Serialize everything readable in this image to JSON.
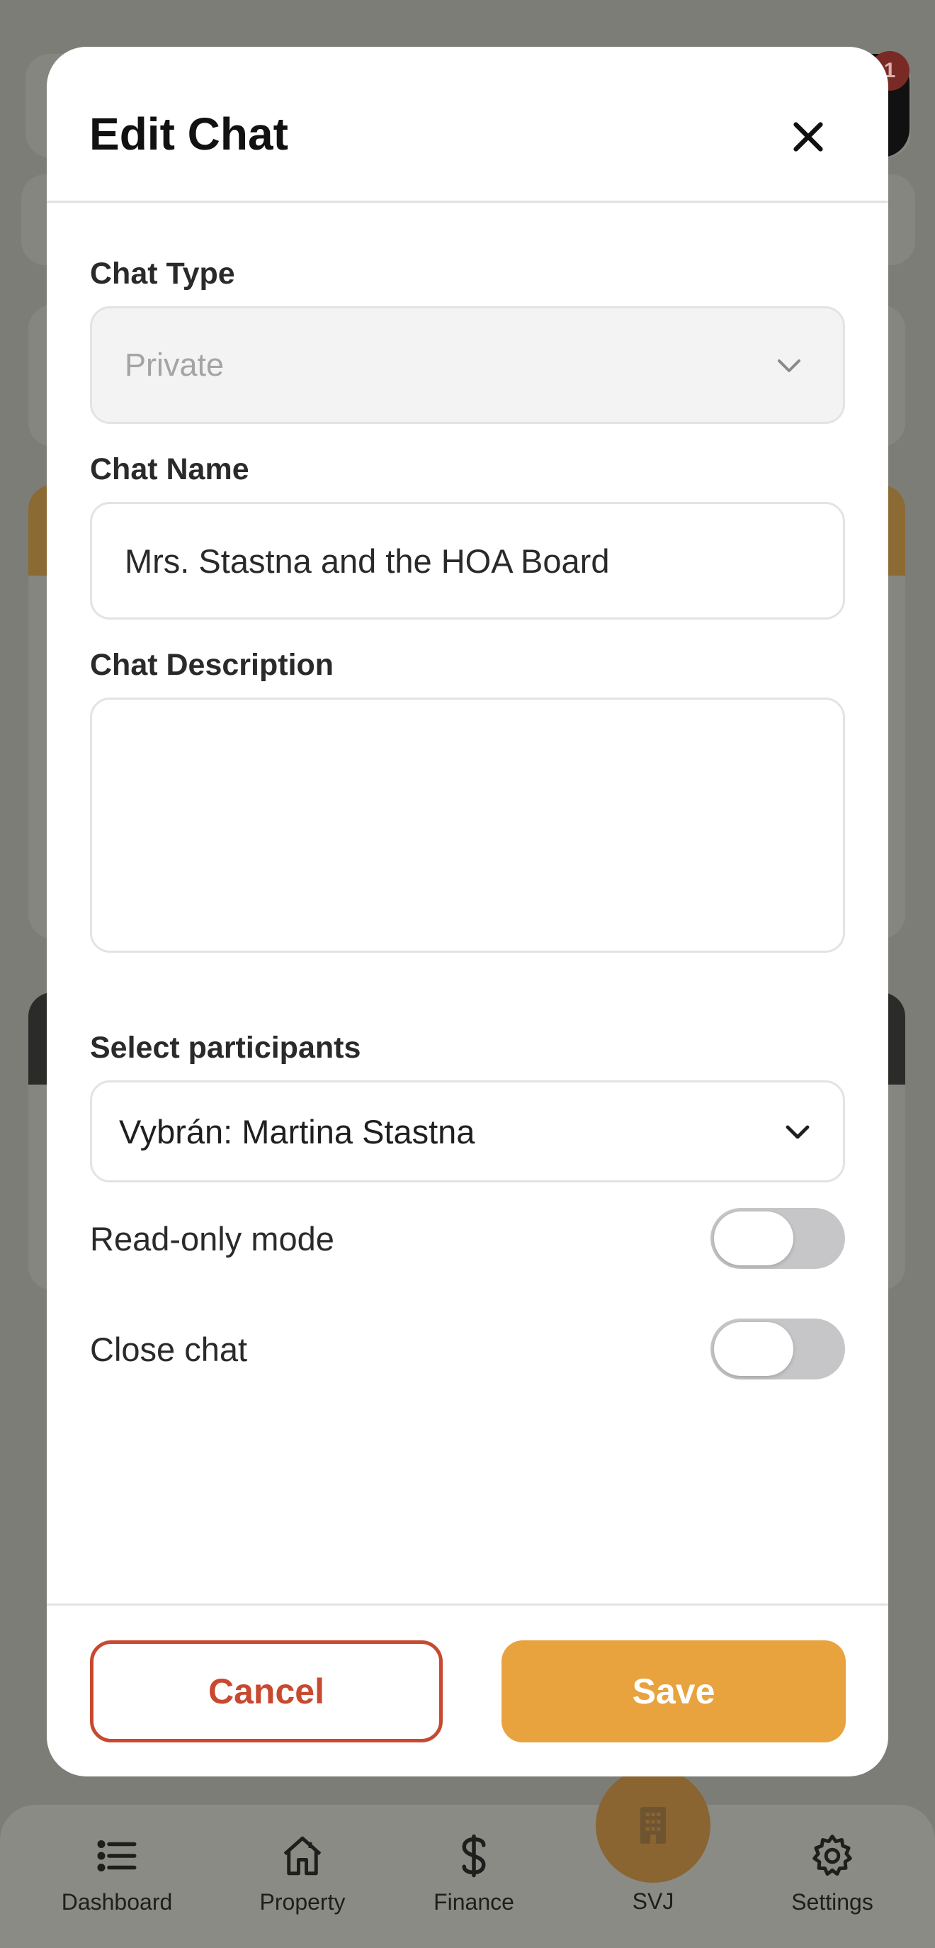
{
  "background": {
    "badge_count": "1",
    "nav": {
      "dashboard": "Dashboard",
      "property": "Property",
      "finance": "Finance",
      "svj": "SVJ",
      "settings": "Settings"
    }
  },
  "modal": {
    "title": "Edit Chat",
    "chat_type": {
      "label": "Chat Type",
      "value": "Private"
    },
    "chat_name": {
      "label": "Chat Name",
      "value": "Mrs. Stastna and the HOA Board"
    },
    "chat_description": {
      "label": "Chat Description",
      "value": ""
    },
    "participants": {
      "label": "Select participants",
      "value": "Vybrán: Martina Stastna"
    },
    "read_only": {
      "label": "Read-only mode",
      "on": false
    },
    "close_chat": {
      "label": "Close chat",
      "on": false
    },
    "cancel_label": "Cancel",
    "save_label": "Save"
  },
  "colors": {
    "accent": "#e8a33e",
    "danger": "#c8492f",
    "overlay": "#7d7d78"
  }
}
